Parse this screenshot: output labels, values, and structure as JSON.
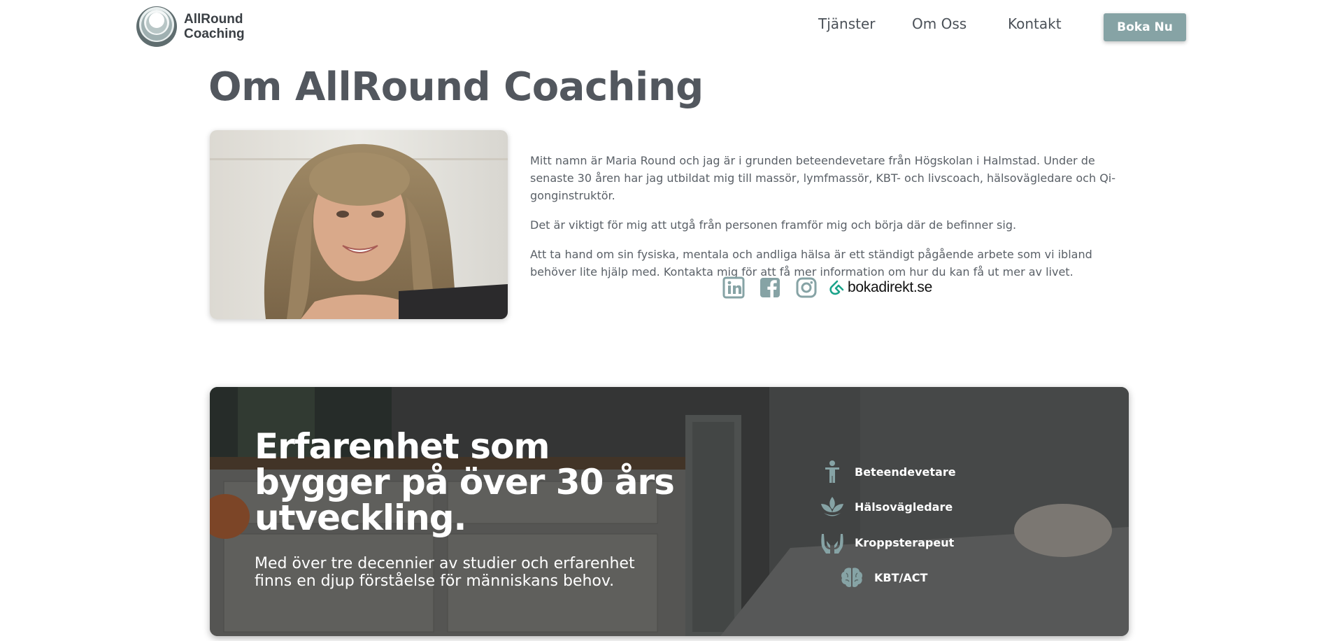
{
  "header": {
    "logo_line1": "AllRound",
    "logo_line2": "Coaching",
    "nav": [
      "Tjänster",
      "Om Oss",
      "Kontakt"
    ],
    "cta_label": "Boka Nu"
  },
  "about": {
    "title": "Om AllRound Coaching",
    "paragraphs": [
      "Mitt namn är Maria Round och jag är i grunden beteendevetare från Högskolan i Halmstad. Under de senaste 30 åren har jag utbildat mig till massör, lymfmassör, KBT- och livscoach, hälsovägledare och Qi-gonginstruktör.",
      "Det är viktigt för mig att utgå från personen framför mig och börja där de befinner sig.",
      "Att ta hand om sin fysiska, mentala och andliga hälsa är ett ständigt pågående arbete som vi ibland behöver lite hjälp med. Kontakta mig för att få mer information om hur du kan få ut mer av livet."
    ],
    "social": {
      "icons": [
        "linkedin-icon",
        "facebook-icon",
        "instagram-icon"
      ],
      "bokadirekt_label": "bokadirekt.se"
    }
  },
  "banner": {
    "title": "Erfarenhet som bygger på över 30 års utveckling.",
    "subtitle": "Med över tre decennier av studier och erfarenhet finns en djup förståelse för människans behov.",
    "features": [
      {
        "label": "Beteendevetare",
        "icon": "person-icon"
      },
      {
        "label": "Hälsovägledare",
        "icon": "lotus-icon"
      },
      {
        "label": "Kroppsterapeut",
        "icon": "hands-icon"
      },
      {
        "label": "KBT/ACT",
        "icon": "brain-icon"
      }
    ]
  },
  "colors": {
    "accent": "#86a3a5",
    "heading": "#52575e",
    "text": "#5a6067"
  }
}
